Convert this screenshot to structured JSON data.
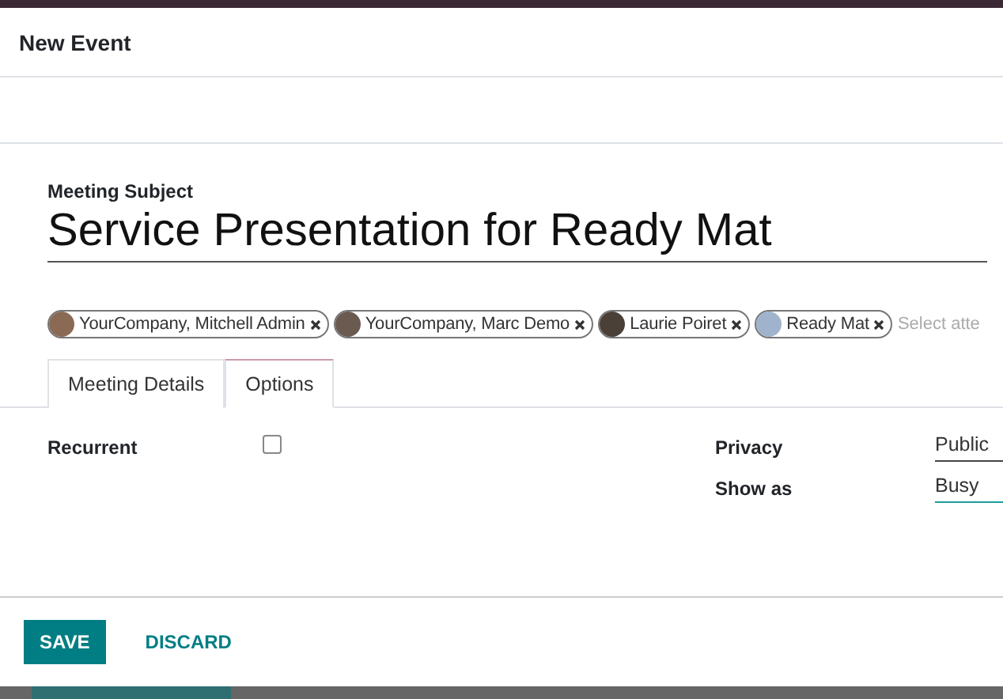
{
  "dialog": {
    "title": "New Event"
  },
  "subject": {
    "label": "Meeting Subject",
    "value": "Service Presentation for Ready Mat"
  },
  "attendees": [
    {
      "name": "YourCompany, Mitchell Admin"
    },
    {
      "name": "YourCompany, Marc Demo"
    },
    {
      "name": "Laurie Poiret"
    },
    {
      "name": "Ready Mat"
    }
  ],
  "attendee_placeholder": "Select atte",
  "tabs": [
    {
      "label": "Meeting Details",
      "selected": false
    },
    {
      "label": "Options",
      "selected": true
    }
  ],
  "recurrent": {
    "label": "Recurrent",
    "checked": false
  },
  "fields": [
    {
      "label": "Privacy",
      "value": "Public",
      "focused": false
    },
    {
      "label": "Show as",
      "value": "Busy",
      "focused": true
    }
  ],
  "buttons": [
    {
      "label": "SAVE",
      "kind": "primary"
    },
    {
      "label": "DISCARD",
      "kind": "link"
    }
  ]
}
